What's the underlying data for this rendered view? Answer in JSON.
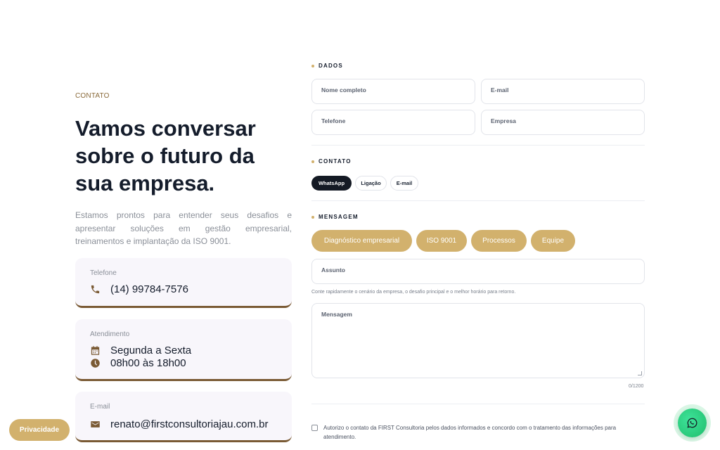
{
  "contact": {
    "eyebrow": "CONTATO",
    "headline": "Vamos conversar sobre o futuro da sua empresa.",
    "intro": "Estamos prontos para entender seus desafios e apresentar soluções em gestão empresarial, treinamentos e implantação da ISO 9001.",
    "cards": {
      "phone": {
        "title": "Telefone",
        "value": "(14) 99784-7576",
        "icon": "phone-icon"
      },
      "hours": {
        "title": "Atendimento",
        "days": "Segunda a Sexta",
        "time": "08h00 às 18h00",
        "icons": [
          "calendar-icon",
          "clock-icon"
        ]
      },
      "email": {
        "title": "E-mail",
        "value": "renato@firstconsultoriajau.com.br",
        "icon": "envelope-icon"
      }
    }
  },
  "form": {
    "dados": {
      "label": "DADOS",
      "fields": {
        "name": "Nome completo",
        "email": "E-mail",
        "phone": "Telefone",
        "company": "Empresa"
      }
    },
    "contato": {
      "label": "CONTATO",
      "options": [
        "WhatsApp",
        "Ligação",
        "E-mail"
      ],
      "selected": "WhatsApp"
    },
    "mensagem": {
      "label": "MENSAGEM",
      "chips": [
        "Diagnóstico empresarial",
        "ISO 9001",
        "Processos",
        "Equipe"
      ],
      "subject_placeholder": "Assunto",
      "hint": "Conte rapidamente o cenário da empresa, o desafio principal e o melhor horário para retorno.",
      "message_placeholder": "Mensagem",
      "counter": "0/1200"
    },
    "consent": "Autorizo o contato da FIRST Consultoria pelos dados informados e concordo com o tratamento das informações para atendimento."
  },
  "floating": {
    "privacy_label": "Privacidade",
    "whatsapp_icon": "whatsapp-icon"
  },
  "colors": {
    "accent_gold": "#d2b16d",
    "brown": "#7a5a34",
    "dark": "#141c2b",
    "whatsapp_green": "#25d366"
  }
}
